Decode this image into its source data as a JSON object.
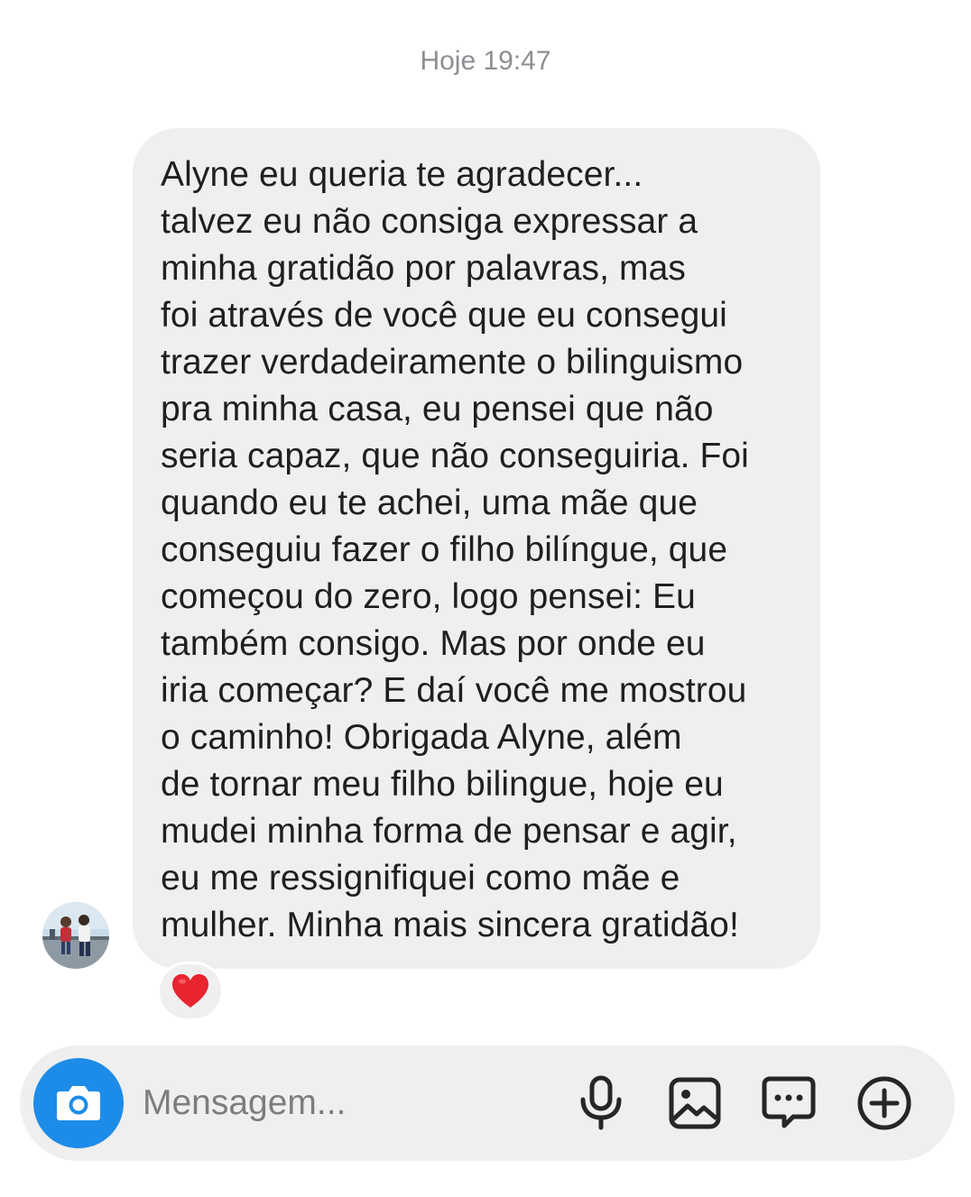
{
  "conversation": {
    "timestamp": "Hoje 19:47"
  },
  "message": {
    "lines": [
      "Alyne eu queria te agradecer...",
      "talvez eu não consiga expressar a",
      "minha gratidão por palavras, mas",
      "foi através de você que eu consegui",
      "trazer verdadeiramente o bilinguismo",
      "pra minha casa, eu pensei que não",
      "seria capaz, que não conseguiria. Foi",
      "quando eu te achei, uma mãe que",
      "conseguiu fazer o filho bilíngue, que",
      "começou do zero, logo pensei: Eu",
      "também consigo. Mas por onde eu",
      "iria começar? E daí você me mostrou",
      "o caminho! Obrigada Alyne, além",
      "de tornar meu filho bilingue, hoje eu",
      "mudei minha forma de pensar e agir,",
      "eu me ressignifiquei como mãe e",
      "mulher. Minha mais sincera gratidão!"
    ],
    "reaction": "heart-emoji"
  },
  "composer": {
    "placeholder": "Mensagem...",
    "value": "",
    "icons": [
      "camera-icon",
      "microphone-icon",
      "gallery-icon",
      "sticker-icon",
      "plus-icon"
    ],
    "accent_color": "#1d8ce8"
  }
}
